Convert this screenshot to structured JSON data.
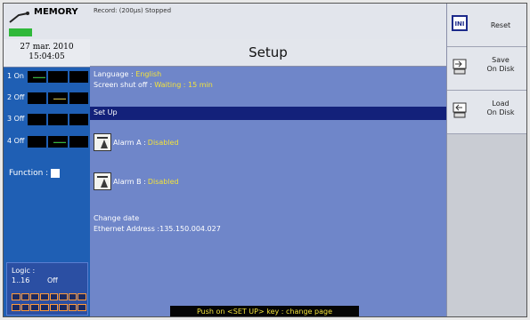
{
  "header": {
    "app_name": "MEMORY",
    "record_status": "Record: (200µs) Stopped",
    "date": "27 mar. 2010",
    "time": "15:04:05"
  },
  "channels": [
    {
      "label": "1 On"
    },
    {
      "label": "2 Off"
    },
    {
      "label": "3 Off"
    },
    {
      "label": "4 Off"
    }
  ],
  "function_label": "Function :",
  "logic": {
    "label": "Logic :",
    "range": "1..16",
    "state": "Off"
  },
  "setup": {
    "title": "Setup",
    "language_label": "Language :",
    "language_value": "English",
    "screen_label": "Screen shut off :",
    "screen_value": "Waiting : 15 min",
    "section_label": "Set Up",
    "alarm_a_label": "Alarm A :",
    "alarm_a_value": "Disabled",
    "alarm_b_label": "Alarm B :",
    "alarm_b_value": "Disabled",
    "change_date": "Change date",
    "ethernet": "Ethernet Address :135.150.004.027",
    "bottom_message": "Push on <SET UP> key : change page"
  },
  "menu": {
    "reset_icon_text": "INI",
    "reset": "Reset",
    "save_line1": "Save",
    "save_line2": "On Disk",
    "load_line1": "Load",
    "load_line2": "On Disk"
  },
  "colors": {
    "accent_yellow": "#f2e23b",
    "section_band": "#13217a",
    "panel_blue": "#6f86c9"
  }
}
